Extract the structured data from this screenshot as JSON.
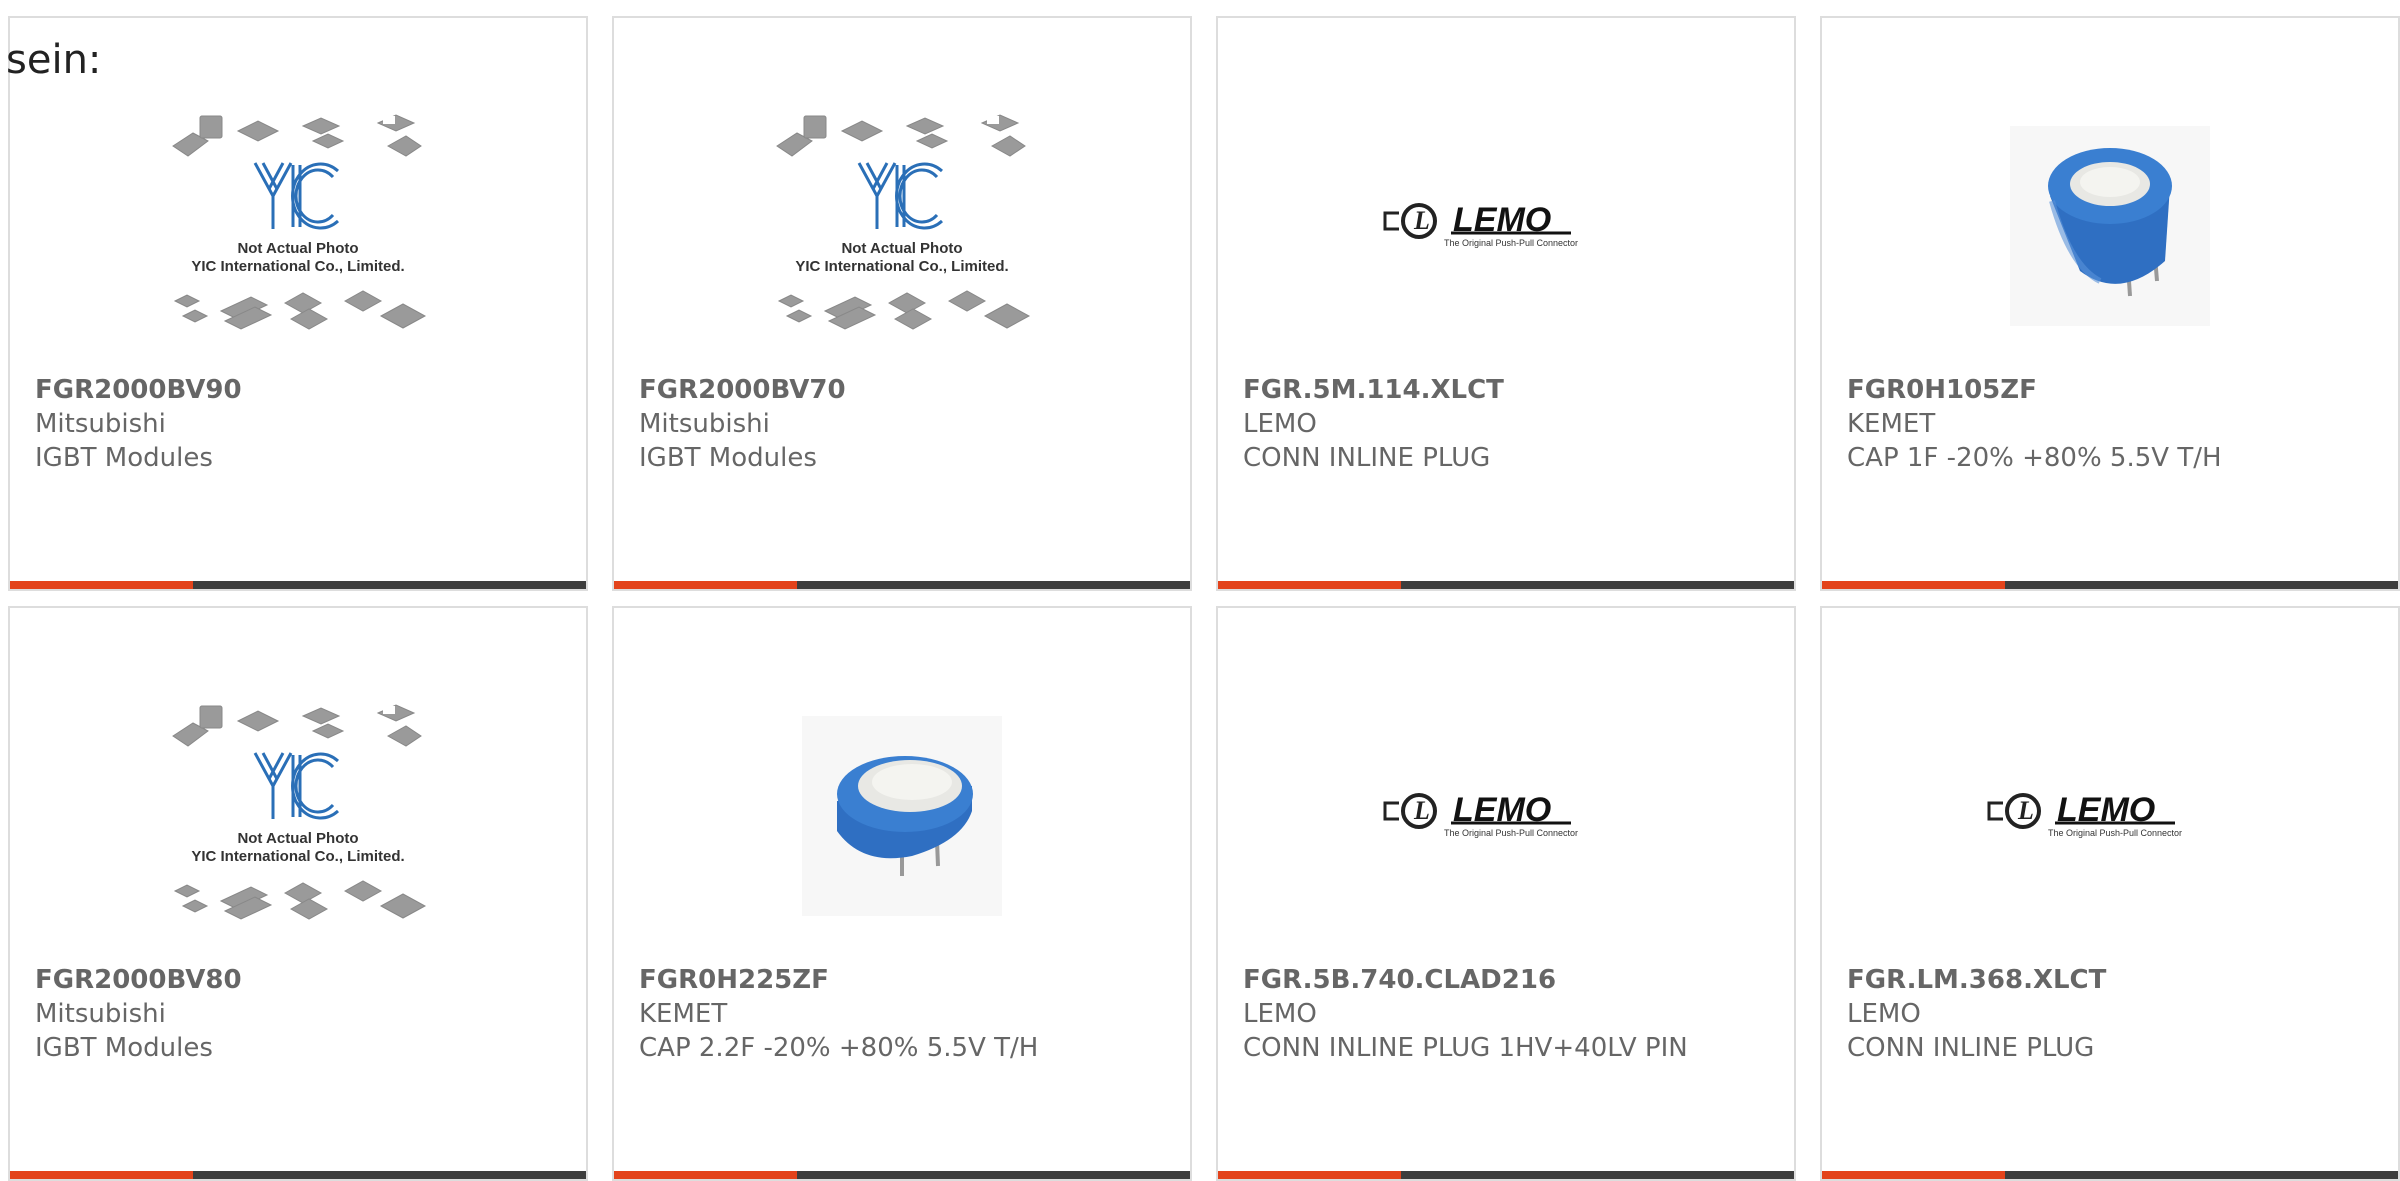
{
  "intro_text": "sein:",
  "colors": {
    "accent": "#e3431b",
    "bar": "#3d3d3d",
    "capacitor_blue": "#2f6fc2"
  },
  "images": {
    "placeholder_caption_1": "Not Actual Photo",
    "placeholder_caption_2": "YIC International Co., Limited.",
    "placeholder_logo": "YIC",
    "lemo_logo": "LEMO",
    "lemo_tagline": "The Original Push-Pull Connector"
  },
  "products": [
    {
      "part_number": "FGR2000BV90",
      "manufacturer": "Mitsubishi",
      "description": "IGBT Modules",
      "image": "yic-placeholder"
    },
    {
      "part_number": "FGR2000BV70",
      "manufacturer": "Mitsubishi",
      "description": "IGBT Modules",
      "image": "yic-placeholder"
    },
    {
      "part_number": "FGR.5M.114.XLCT",
      "manufacturer": "LEMO",
      "description": "CONN INLINE PLUG",
      "image": "lemo-logo"
    },
    {
      "part_number": "FGR0H105ZF",
      "manufacturer": "KEMET",
      "description": "CAP 1F -20% +80% 5.5V T/H",
      "image": "capacitor-tall"
    },
    {
      "part_number": "FGR2000BV80",
      "manufacturer": "Mitsubishi",
      "description": "IGBT Modules",
      "image": "yic-placeholder"
    },
    {
      "part_number": "FGR0H225ZF",
      "manufacturer": "KEMET",
      "description": "CAP 2.2F -20% +80% 5.5V T/H",
      "image": "capacitor-flat"
    },
    {
      "part_number": "FGR.5B.740.CLAD216",
      "manufacturer": "LEMO",
      "description": "CONN INLINE PLUG 1HV+40LV PIN",
      "image": "lemo-logo"
    },
    {
      "part_number": "FGR.LM.368.XLCT",
      "manufacturer": "LEMO",
      "description": "CONN INLINE PLUG",
      "image": "lemo-logo"
    }
  ]
}
